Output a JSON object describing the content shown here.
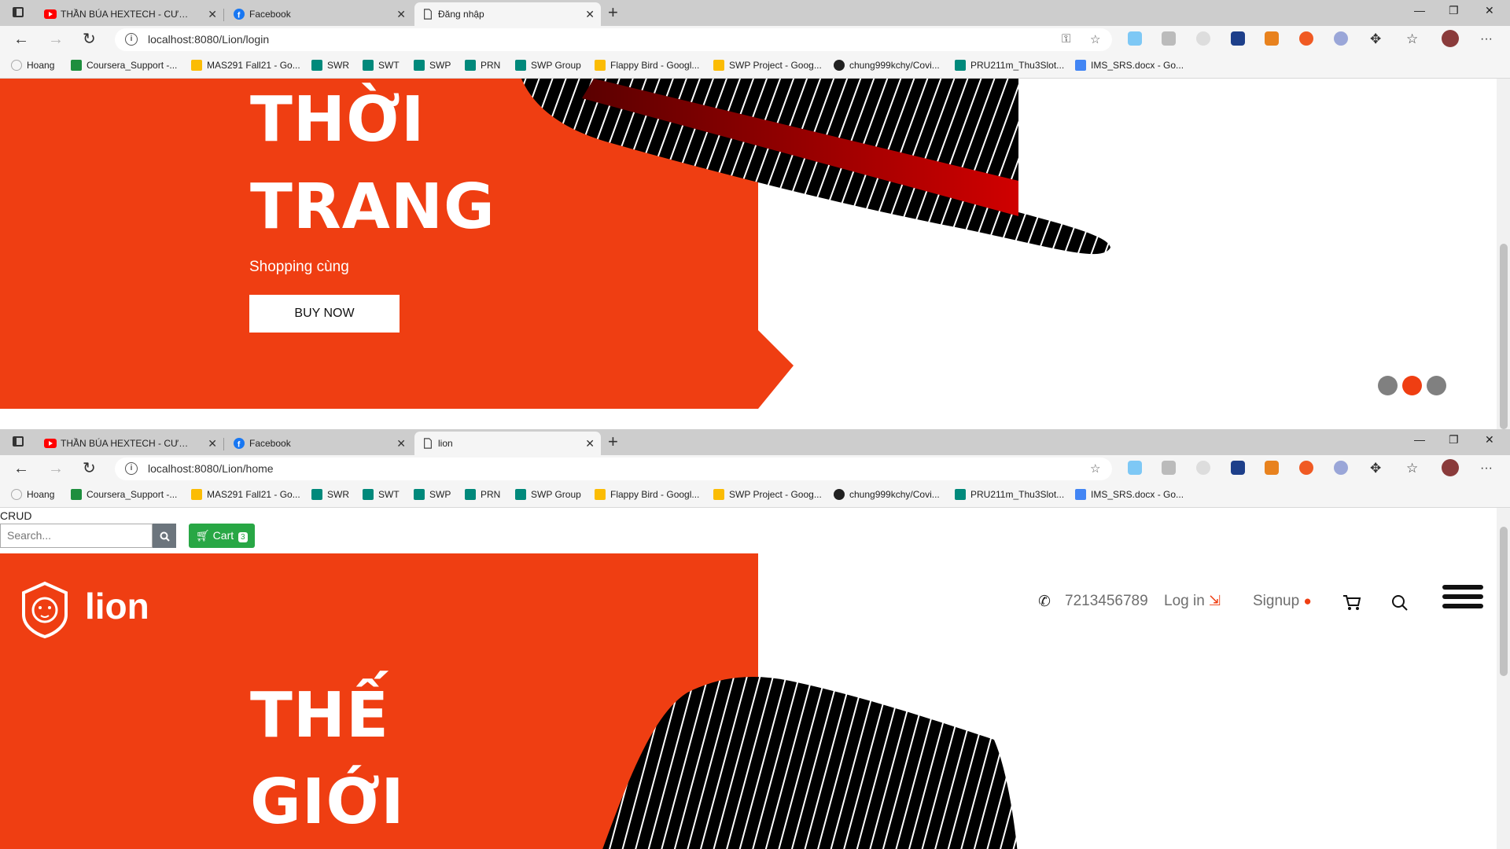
{
  "windows": [
    {
      "tabs": [
        {
          "title": "THẦN BÚA HEXTECH - CƯỜNG ..."
        },
        {
          "title": "Facebook"
        },
        {
          "title": "Đăng nhập"
        }
      ],
      "url": "localhost:8080/Lion/login",
      "hero": {
        "line1": "THỜI",
        "line2": "TRANG",
        "subtitle": "Shopping cùng",
        "button": "BUY NOW"
      }
    },
    {
      "tabs": [
        {
          "title": "THẦN BÚA HEXTECH - CƯỜNG ..."
        },
        {
          "title": "Facebook"
        },
        {
          "title": "lion"
        }
      ],
      "url": "localhost:8080/Lion/home",
      "crud_label": "CRUD",
      "search_placeholder": "Search...",
      "cart_label": "Cart",
      "cart_count": "3",
      "brand": "lion",
      "phone": "7213456789",
      "login": "Log in",
      "signup": "Signup",
      "hero": {
        "line1": "THẾ",
        "line2": "GIỚI"
      }
    }
  ],
  "bookmarks": [
    "Hoang",
    "Coursera_Support -...",
    "MAS291 Fall21 - Go...",
    "SWR",
    "SWT",
    "SWP",
    "PRN",
    "SWP Group",
    "Flappy Bird - Googl...",
    "SWP Project - Goog...",
    "chung999kchy/Covi...",
    "PRU211m_Thu3Slot...",
    "IMS_SRS.docx - Go..."
  ],
  "colors": {
    "brand_orange": "#ef3e12",
    "cart_green": "#28a745",
    "slider_dot_active": "#ef3e12",
    "slider_dot_inactive": "#808080"
  },
  "slider": {
    "dot_count": 3,
    "active_index": 1
  }
}
